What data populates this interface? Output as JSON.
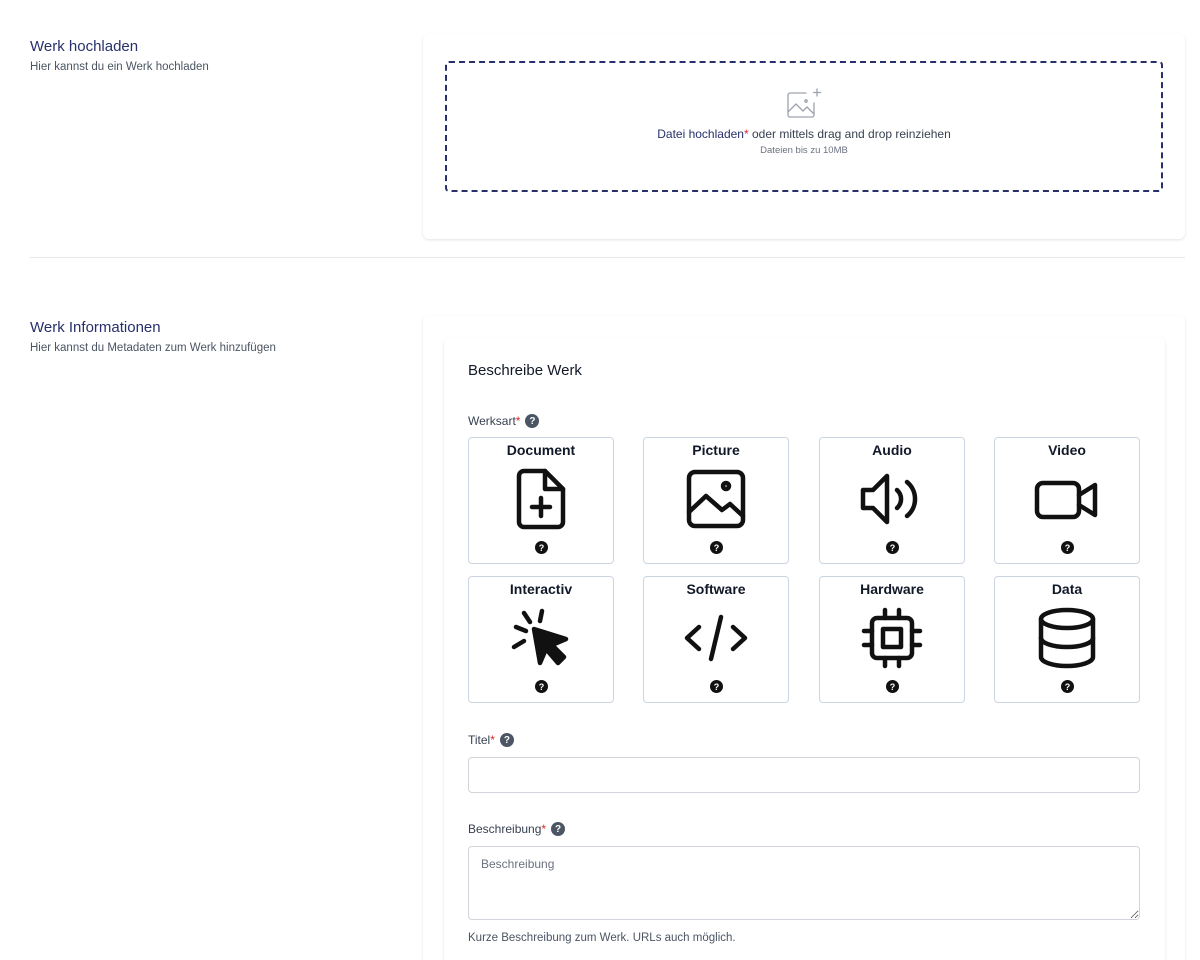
{
  "upload_section": {
    "title": "Werk hochladen",
    "subtitle": "Hier kannst du ein Werk hochladen",
    "dropzone": {
      "link_label": "Datei hochladen",
      "required_mark": "*",
      "drag_text": " oder mittels drag and drop reinziehen",
      "hint": "Dateien bis zu 10MB",
      "icon": "image-plus-icon"
    }
  },
  "info_section": {
    "title": "Werk Informationen",
    "subtitle": "Hier kannst du Metadaten zum Werk hinzufügen"
  },
  "form": {
    "heading": "Beschreibe Werk",
    "werksart": {
      "label": "Werksart",
      "required_mark": "*",
      "help": "?"
    },
    "types": [
      {
        "label": "Document",
        "icon": "document-plus-icon",
        "help": "?"
      },
      {
        "label": "Picture",
        "icon": "picture-icon",
        "help": "?"
      },
      {
        "label": "Audio",
        "icon": "speaker-icon",
        "help": "?"
      },
      {
        "label": "Video",
        "icon": "video-camera-icon",
        "help": "?"
      },
      {
        "label": "Interactiv",
        "icon": "cursor-click-icon",
        "help": "?"
      },
      {
        "label": "Software",
        "icon": "code-icon",
        "help": "?"
      },
      {
        "label": "Hardware",
        "icon": "chip-icon",
        "help": "?"
      },
      {
        "label": "Data",
        "icon": "database-icon",
        "help": "?"
      }
    ],
    "title_field": {
      "label": "Titel",
      "required_mark": "*",
      "help": "?",
      "value": ""
    },
    "description_field": {
      "label": "Beschreibung",
      "required_mark": "*",
      "help": "?",
      "placeholder": "Beschreibung",
      "value": "",
      "hint": "Kurze Beschreibung zum Werk. URLs auch möglich."
    }
  },
  "colors": {
    "accent": "#27306b",
    "required": "#dc2626"
  }
}
